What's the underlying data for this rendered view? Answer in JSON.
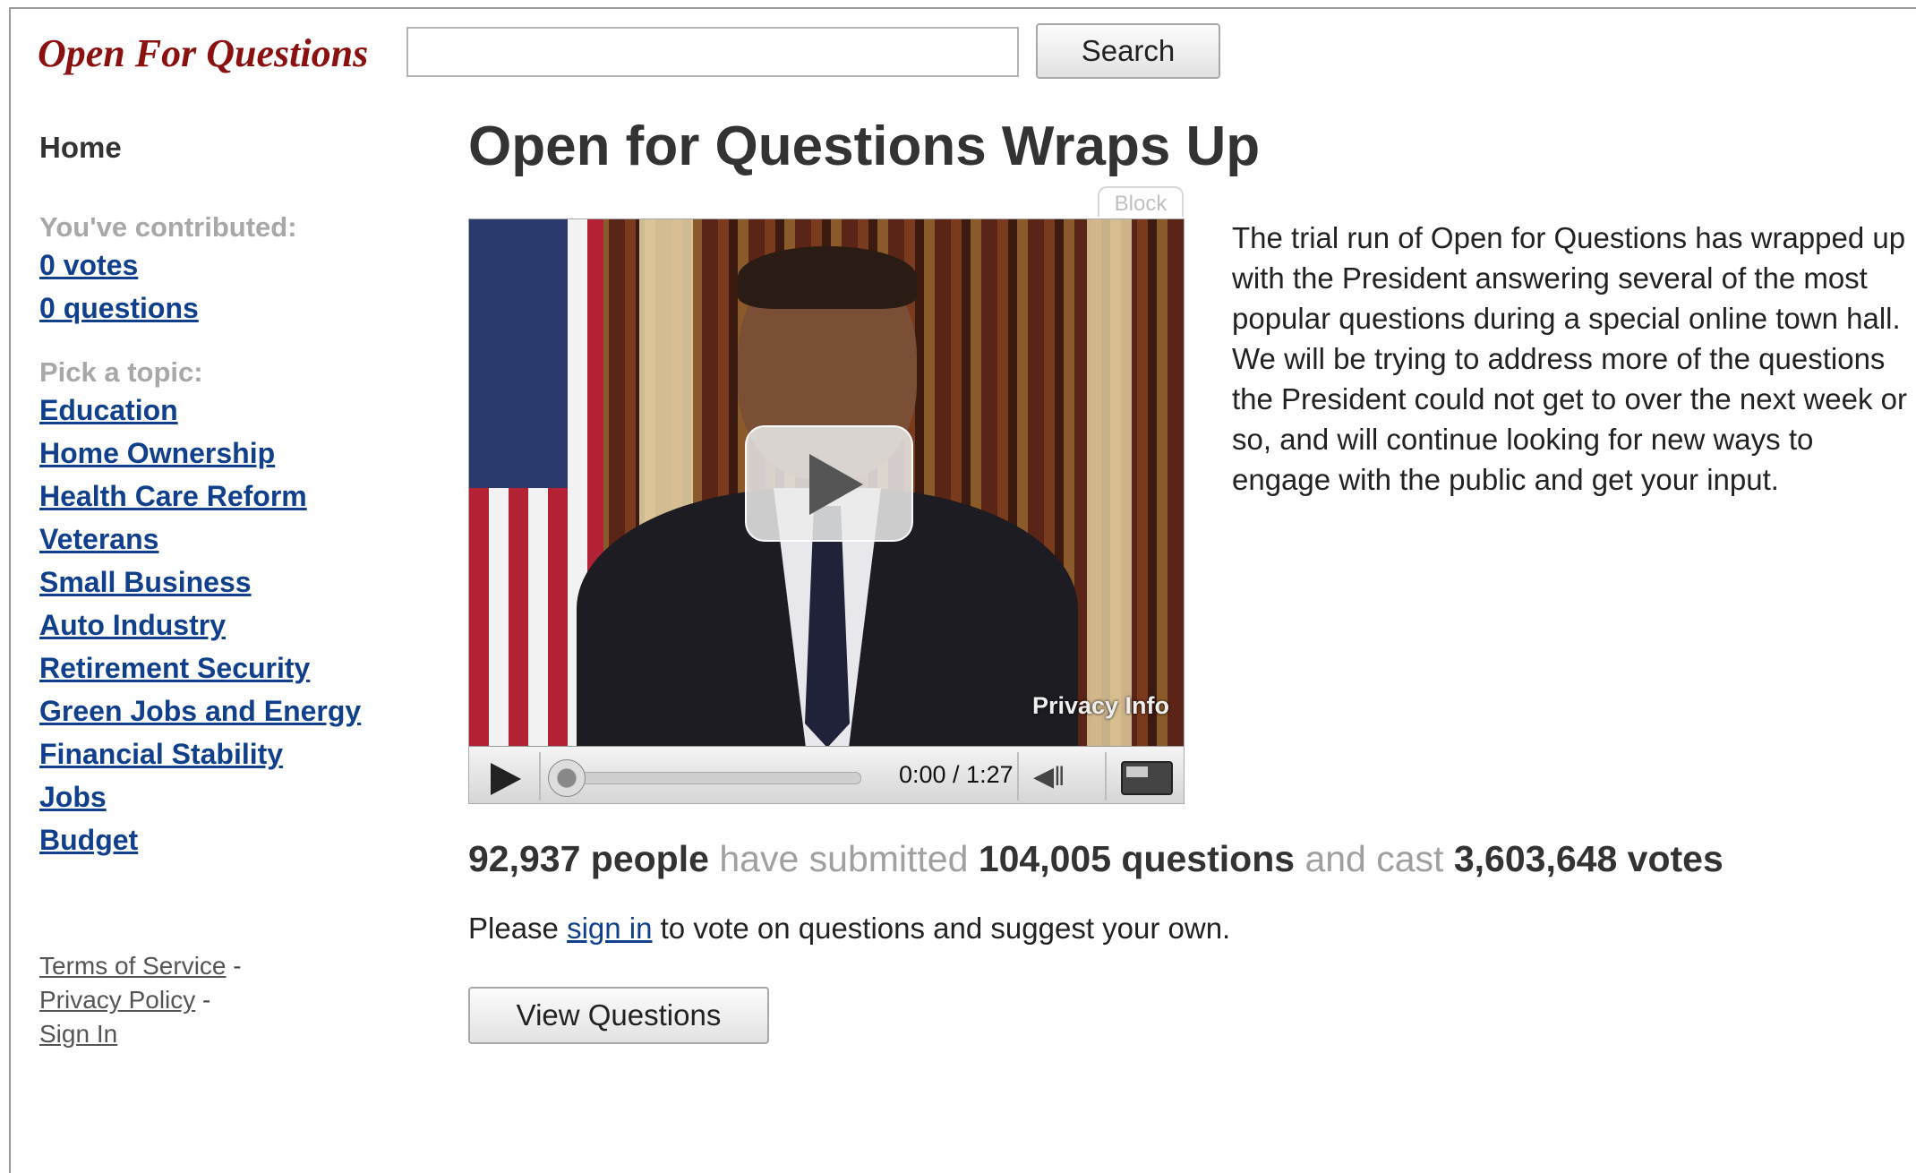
{
  "header": {
    "logo_text": "Open For Questions",
    "search_value": "",
    "search_button": "Search"
  },
  "sidebar": {
    "home": "Home",
    "contributed_label": "You've contributed:",
    "votes_link": "0 votes",
    "questions_link": "0 questions",
    "topic_label": "Pick a topic:",
    "topics": [
      "Education",
      "Home Ownership",
      "Health Care Reform",
      "Veterans",
      "Small Business",
      "Auto Industry",
      "Retirement Security",
      "Green Jobs and Energy",
      "Financial Stability",
      "Jobs",
      "Budget"
    ],
    "footer": {
      "terms": "Terms of Service",
      "privacy": "Privacy Policy",
      "signin": "Sign In",
      "separator": "-"
    }
  },
  "main": {
    "title": "Open for Questions Wraps Up",
    "block_tag": "Block",
    "video": {
      "privacy_info": "Privacy Info",
      "time": "0:00 / 1:27",
      "progress_fraction": 0
    },
    "description": "The trial run of Open for Questions has wrapped up with the President answering several of the most popular questions during a special online town hall. We will be trying to address more of the questions the President could not get to over the next week or so, and will continue looking for new ways to engage with the public and get your input.",
    "stats": {
      "people": "92,937 people",
      "have_submitted": "have submitted",
      "questions": "104,005 questions",
      "and_cast": "and cast",
      "votes": "3,603,648 votes"
    },
    "signin_prompt": {
      "before": "Please",
      "link": "sign in",
      "after": "to vote on questions and suggest your own."
    },
    "view_button": "View Questions"
  },
  "colors": {
    "logo": "#8b1010",
    "link": "#10408c",
    "muted": "#a8a8a8"
  }
}
